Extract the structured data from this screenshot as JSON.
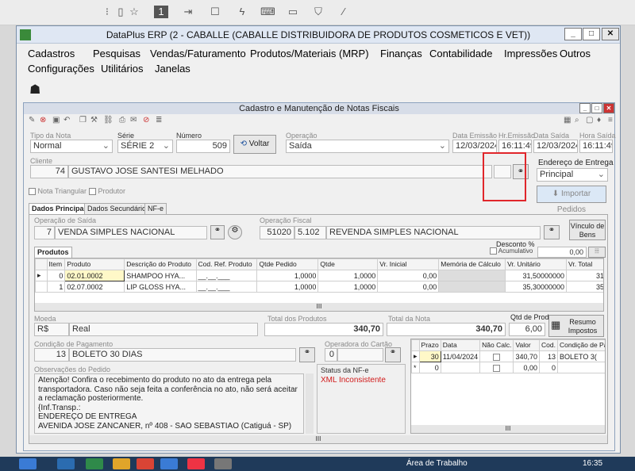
{
  "window": {
    "title": "DataPlus ERP (2 - CABALLE  (CABALLE DISTRIBUIDORA DE PRODUTOS COSMETICOS E VET))"
  },
  "menu": {
    "row1": [
      "Cadastros",
      "Pesquisas",
      "Vendas/Faturamento",
      "Produtos/Materiais (MRP)",
      "Finanças",
      "Contabilidade",
      "Impressões",
      "Outros"
    ],
    "row2": [
      "Configurações",
      "Utilitários",
      "Janelas"
    ]
  },
  "subwindow": {
    "title": "Cadastro e Manutenção de Notas Fiscais"
  },
  "form": {
    "tipo_nota": {
      "label": "Tipo da Nota",
      "value": "Normal"
    },
    "serie": {
      "label": "Série",
      "value": "SÉRIE 2"
    },
    "numero": {
      "label": "Número",
      "value": "509"
    },
    "voltar": "Voltar",
    "operacao": {
      "label": "Operação",
      "value": "Saída"
    },
    "data_emissao": {
      "label": "Data Emissão",
      "value": "12/03/2024"
    },
    "hr_emissao": {
      "label": "Hr.Emissão",
      "value": "16:11:49"
    },
    "data_saida": {
      "label": "Data Saída",
      "value": "12/03/2024"
    },
    "hora_saida": {
      "label": "Hora Saída",
      "value": "16:11:49"
    },
    "cliente": {
      "label": "Cliente",
      "code": "74",
      "name": "GUSTAVO JOSE SANTESI MELHADO"
    },
    "endereco_entrega": {
      "label": "Endereço de Entrega",
      "value": "Principal"
    },
    "nota_triangular": "Nota Triangular",
    "produtor": "Produtor",
    "importar_pedidos": "Importar Pedidos"
  },
  "tabs": [
    "Dados Principais",
    "Dados Secundários",
    "NF-e"
  ],
  "operacao_saida": {
    "label": "Operação de Saída",
    "code": "7",
    "name": "VENDA SIMPLES NACIONAL"
  },
  "operacao_fiscal": {
    "label": "Operação Fiscal",
    "code": "51020",
    "cfop": "5.102",
    "name": "REVENDA SIMPLES NACIONAL"
  },
  "vinculo_bens": "Vínculo de Bens",
  "desconto": {
    "label": "Desconto %",
    "acumulativo": "Acumulativo",
    "value": "0,00"
  },
  "produtos_tab": "Produtos",
  "produtos_table": {
    "headers": [
      "Item",
      "Produto",
      "Descrição do Produto",
      "Cod. Ref. Produto",
      "Qtde Pedido",
      "Qtde",
      "Vr. Inicial",
      "Memória de Cálculo",
      "Vr. Unitário",
      "Vr. Total"
    ],
    "rows": [
      [
        "0",
        "02.01.0002",
        "SHAMPOO HYA...",
        "__.__.___",
        "1,0000",
        "1,0000",
        "0,00",
        "",
        "31,50000000",
        "31"
      ],
      [
        "1",
        "02.07.0002",
        "LIP GLOSS HYA...",
        "__.__.___",
        "1,0000",
        "1,0000",
        "0,00",
        "",
        "35,30000000",
        "35"
      ]
    ]
  },
  "moeda": {
    "label": "Moeda",
    "code": "R$",
    "name": "Real"
  },
  "total_produtos": {
    "label": "Total dos Produtos",
    "value": "340,70"
  },
  "total_nota": {
    "label": "Total da Nota",
    "value": "340,70"
  },
  "qtd_prod": {
    "label": "Qtd de Prod.",
    "value": "6,00"
  },
  "resumo_impostos": "Resumo Impostos",
  "condicao_pagamento": {
    "label": "Condição de Pagamento",
    "code": "13",
    "name": "BOLETO 30 DIAS"
  },
  "operadora_cartao": {
    "label": "Operadora do Cartão",
    "code": "0"
  },
  "observacoes": {
    "label": "Observações do Pedido",
    "lines": [
      "Atenção! Confira o recebimento do produto no ato da entrega pela",
      "transportadora. Caso não seja feita a conferência no ato, não será aceitar",
      "a reclamação posteriormente.",
      "{Inf.Transp.:",
      "ENDEREÇO DE ENTREGA",
      "AVENIDA JOSE ZANCANER, nº 408 - SAO SEBASTIAO (Catiguá - SP)"
    ]
  },
  "status_nfe": {
    "label": "Status da NF-e",
    "value": "XML Inconsistente"
  },
  "parcelas_table": {
    "headers": [
      "Prazo",
      "Data",
      "Não Calc.",
      "Valor",
      "Cod.",
      "Condição de Pagto"
    ],
    "rows": [
      [
        "30",
        "11/04/2024",
        "",
        "340,70",
        "13",
        "BOLETO 3("
      ],
      [
        "0",
        "",
        "",
        "0,00",
        "0",
        ""
      ]
    ]
  },
  "taskbar": {
    "area_trabalho": "Área de Trabalho",
    "time": "16:35"
  },
  "colors": {
    "highlight_box": "#e0262b",
    "status_error": "#d11a1a",
    "accent": "#1a4f9c"
  }
}
